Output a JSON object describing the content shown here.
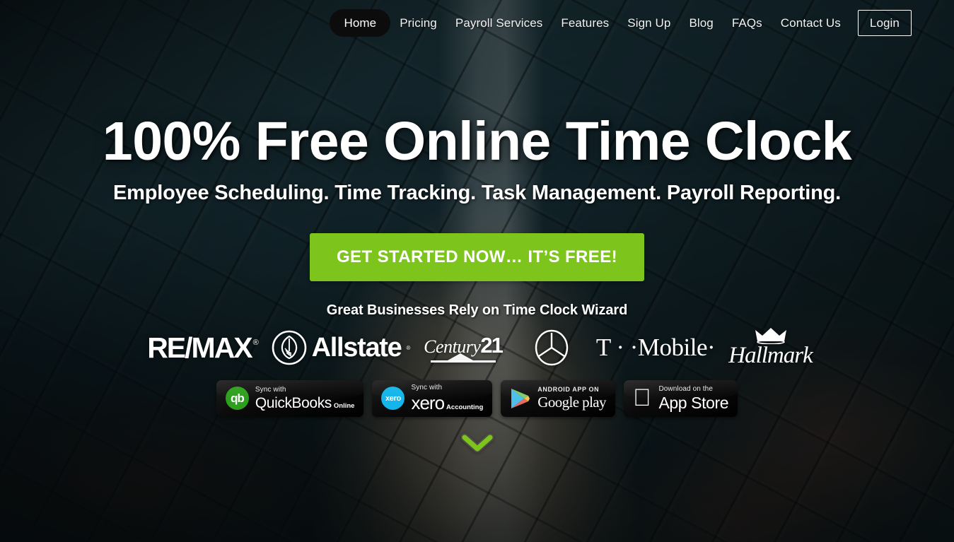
{
  "nav": {
    "items": [
      {
        "label": "Home",
        "name": "nav-home",
        "style": "active"
      },
      {
        "label": "Pricing",
        "name": "nav-pricing",
        "style": "plain"
      },
      {
        "label": "Payroll Services",
        "name": "nav-payroll-services",
        "style": "plain"
      },
      {
        "label": "Features",
        "name": "nav-features",
        "style": "plain"
      },
      {
        "label": "Sign Up",
        "name": "nav-sign-up",
        "style": "plain"
      },
      {
        "label": "Blog",
        "name": "nav-blog",
        "style": "plain"
      },
      {
        "label": "FAQs",
        "name": "nav-faqs",
        "style": "plain"
      },
      {
        "label": "Contact Us",
        "name": "nav-contact-us",
        "style": "plain"
      },
      {
        "label": "Login",
        "name": "nav-login",
        "style": "boxed"
      }
    ]
  },
  "hero": {
    "headline": "100% Free Online Time Clock",
    "subheadline": "Employee Scheduling. Time Tracking. Task Management. Payroll Reporting.",
    "cta_label": "GET STARTED NOW… IT’S FREE!",
    "trust_label": "Great Businesses Rely on Time Clock Wizard",
    "scroll_icon": "chevron-down-icon"
  },
  "logos": [
    {
      "name": "remax-logo",
      "text": "RE/MAX",
      "mark": "®"
    },
    {
      "name": "allstate-logo",
      "text": "Allstate",
      "mark": "®"
    },
    {
      "name": "century21-logo",
      "text": "Century",
      "mark": "21"
    },
    {
      "name": "mercedes-benz-logo",
      "text": "",
      "mark": ""
    },
    {
      "name": "tmobile-logo",
      "text": "T · ·Mobile·",
      "mark": ""
    },
    {
      "name": "hallmark-logo",
      "text": "Hallmark",
      "mark": "crown-icon"
    }
  ],
  "badges": [
    {
      "name": "quickbooks-sync-badge",
      "icon": "quickbooks-icon",
      "icon_text": "qb",
      "small": "Sync with",
      "big": "QuickBooks",
      "tiny": "Online"
    },
    {
      "name": "xero-sync-badge",
      "icon": "xero-icon",
      "icon_text": "xero",
      "small": "Sync with",
      "big": "xero",
      "tiny": "Accounting"
    },
    {
      "name": "google-play-badge",
      "icon": "google-play-icon",
      "icon_text": "",
      "small": "ANDROID APP ON",
      "big": "Google play",
      "tiny": ""
    },
    {
      "name": "app-store-badge",
      "icon": "apple-icon",
      "icon_text": "",
      "small": "Download on the",
      "big": "App Store",
      "tiny": ""
    }
  ],
  "colors": {
    "cta_green": "#7dc51d",
    "chevron_green": "#7dc51d",
    "chevron_outline": "#5a5a52",
    "quickbooks_green": "#2CA01C",
    "xero_blue": "#13B5EA",
    "nav_active_bg": "#0c0c0c",
    "text_white": "#ffffff"
  }
}
